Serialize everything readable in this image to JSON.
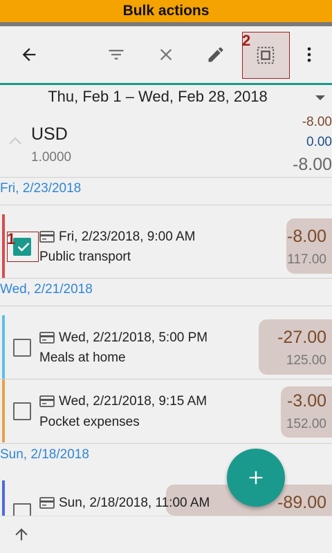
{
  "banner": {
    "title": "Bulk actions"
  },
  "callouts": {
    "select_all": "2",
    "row_checkbox": "1"
  },
  "toolbar": {
    "back_icon": "arrow-left-icon",
    "filter_icon": "filter-icon",
    "clear_icon": "close-icon",
    "edit_icon": "pencil-icon",
    "select_all_icon": "select-all-icon",
    "more_icon": "more-vert-icon"
  },
  "period": {
    "label": "Thu, Feb 1 – Wed, Feb 28, 2018"
  },
  "account": {
    "currency": "USD",
    "rate": "1.0000",
    "expenses": "-8.00",
    "income": "0.00",
    "total": "-8.00"
  },
  "days": [
    {
      "label": "Fri, 2/23/2018",
      "transactions": [
        {
          "datetime": "Fri, 2/23/2018, 9:00 AM",
          "description": "Public transport",
          "amount": "-8.00",
          "balance": "117.00",
          "checked": true,
          "color": "#d94b4b"
        }
      ]
    },
    {
      "label": "Wed, 2/21/2018",
      "transactions": [
        {
          "datetime": "Wed, 2/21/2018, 5:00 PM",
          "description": "Meals at home",
          "amount": "-27.00",
          "balance": "125.00",
          "checked": false,
          "color": "#5bbfe8"
        },
        {
          "datetime": "Wed, 2/21/2018, 9:15 AM",
          "description": "Pocket expenses",
          "amount": "-3.00",
          "balance": "152.00",
          "checked": false,
          "color": "#e8a04b"
        }
      ]
    },
    {
      "label": "Sun, 2/18/2018",
      "transactions": [
        {
          "datetime": "Sun, 2/18/2018, 11:00 AM",
          "description": "",
          "amount": "-89.00",
          "balance": "",
          "checked": false,
          "color": "#4b6bd9"
        }
      ]
    }
  ],
  "colors": {
    "accent": "#1a9a8c",
    "banner": "#f4a300",
    "day_header": "#2f86d6",
    "amount_negative": "#7a4a2a"
  }
}
